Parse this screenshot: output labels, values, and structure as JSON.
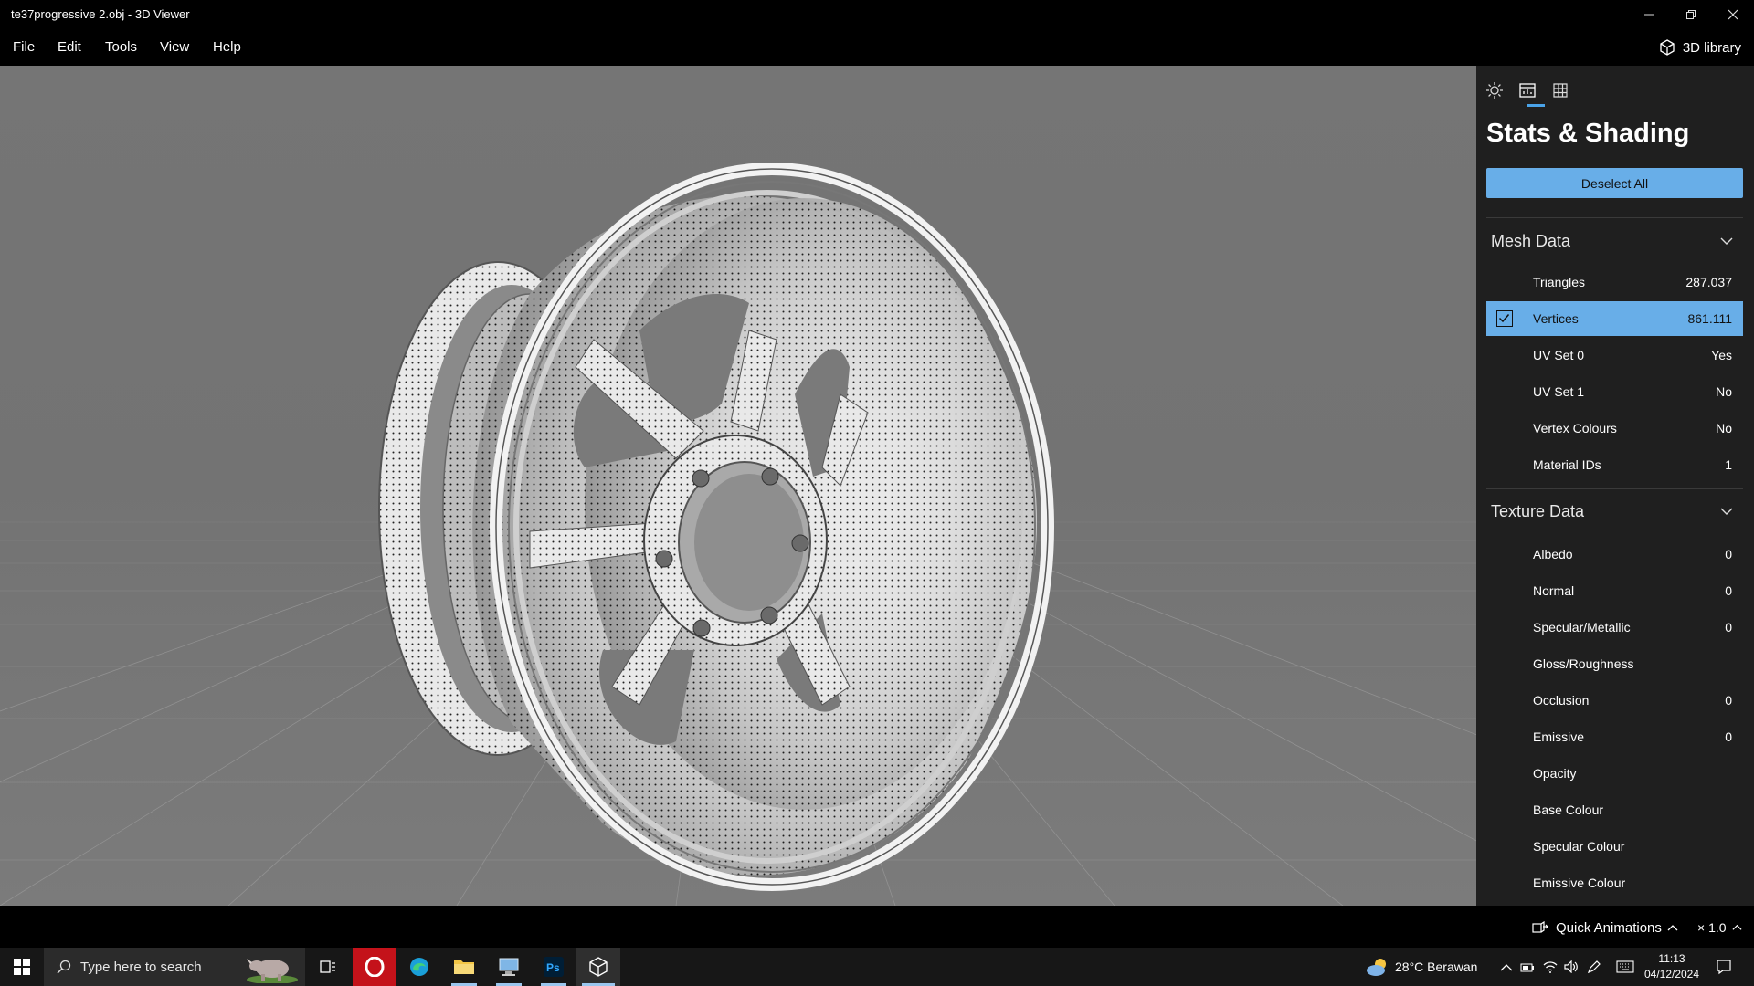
{
  "window": {
    "title": "te37progressive 2.obj - 3D Viewer"
  },
  "menu": {
    "items": [
      "File",
      "Edit",
      "Tools",
      "View",
      "Help"
    ],
    "library_label": "3D library"
  },
  "panel": {
    "tabs": [
      "lighting-tab",
      "stats-tab",
      "grid-tab"
    ],
    "active_tab": "stats-tab",
    "title": "Stats & Shading",
    "deselect_label": "Deselect All",
    "mesh_section": {
      "title": "Mesh Data",
      "rows": [
        {
          "label": "Triangles",
          "value": "287.037"
        },
        {
          "label": "Vertices",
          "value": "861.111",
          "checked": true
        },
        {
          "label": "UV Set 0",
          "value": "Yes"
        },
        {
          "label": "UV Set 1",
          "value": "No"
        },
        {
          "label": "Vertex Colours",
          "value": "No"
        },
        {
          "label": "Material IDs",
          "value": "1"
        }
      ]
    },
    "texture_section": {
      "title": "Texture Data",
      "rows": [
        {
          "label": "Albedo",
          "value": "0"
        },
        {
          "label": "Normal",
          "value": "0"
        },
        {
          "label": "Specular/Metallic",
          "value": "0"
        },
        {
          "label": "Gloss/Roughness",
          "value": ""
        },
        {
          "label": "Occlusion",
          "value": "0"
        },
        {
          "label": "Emissive",
          "value": "0"
        },
        {
          "label": "Opacity",
          "value": ""
        },
        {
          "label": "Base Colour",
          "value": ""
        },
        {
          "label": "Specular Colour",
          "value": ""
        },
        {
          "label": "Emissive Colour",
          "value": ""
        }
      ]
    }
  },
  "bottombar": {
    "quick_animations": "Quick Animations",
    "speed": "× 1.0"
  },
  "taskbar": {
    "search_placeholder": "Type here to search",
    "weather": "28°C  Berawan",
    "time": "11:13",
    "date": "04/12/2024"
  },
  "colors": {
    "accent": "#68aee8",
    "panel_bg": "#1f1f1f",
    "viewport_bg": "#757575"
  }
}
